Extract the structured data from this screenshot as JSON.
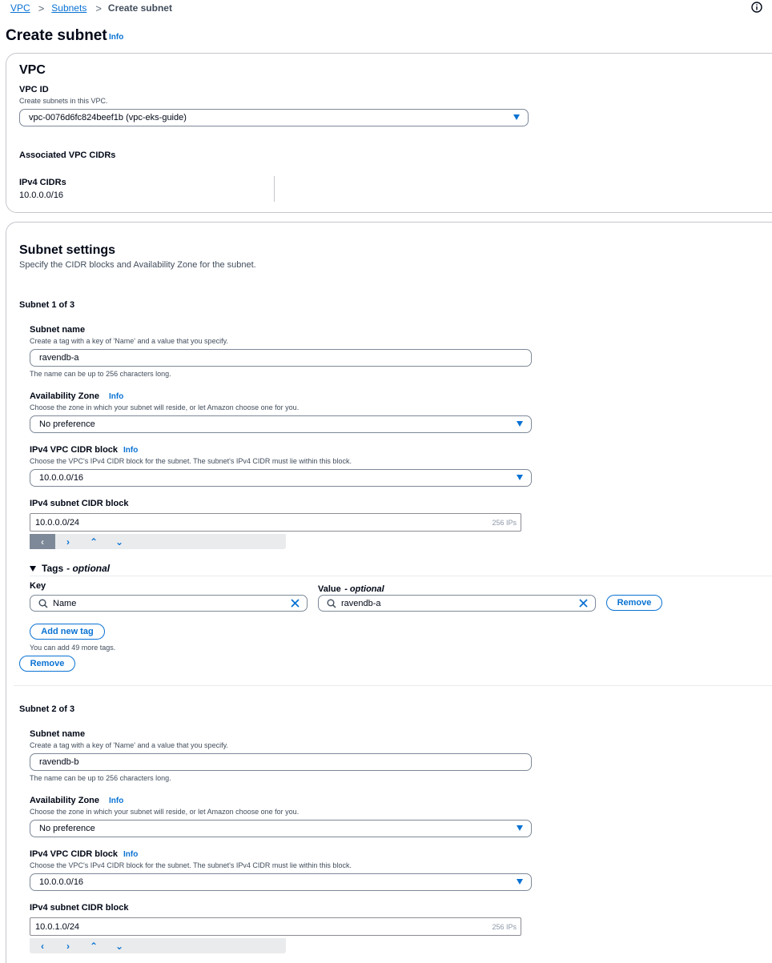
{
  "breadcrumb": {
    "vpc": "VPC",
    "subnets": "Subnets",
    "current": "Create subnet",
    "sep": ">"
  },
  "page": {
    "title": "Create subnet",
    "info": "Info"
  },
  "vpc_panel": {
    "heading": "VPC",
    "vpc_id_label": "VPC ID",
    "vpc_id_desc": "Create subnets in this VPC.",
    "vpc_id_value": "vpc-0076d6fc824beef1b (vpc-eks-guide)",
    "associated_heading": "Associated VPC CIDRs",
    "ipv4_label": "IPv4 CIDRs",
    "ipv4_value": "10.0.0.0/16"
  },
  "settings": {
    "heading": "Subnet settings",
    "desc": "Specify the CIDR blocks and Availability Zone for the subnet."
  },
  "common": {
    "name_label": "Subnet name",
    "name_desc": "Create a tag with a key of 'Name' and a value that you specify.",
    "name_hint": "The name can be up to 256 characters long.",
    "az_label": "Availability Zone",
    "az_desc": "Choose the zone in which your subnet will reside, or let Amazon choose one for you.",
    "az_value": "No preference",
    "vpc_cidr_label": "IPv4 VPC CIDR block",
    "vpc_cidr_desc": "Choose the VPC's IPv4 CIDR block for the subnet. The subnet's IPv4 CIDR must lie within this block.",
    "vpc_cidr_value": "10.0.0.0/16",
    "subnet_cidr_label": "IPv4 subnet CIDR block",
    "ips": "256 IPs",
    "info": "Info"
  },
  "subnet1": {
    "heading": "Subnet 1 of 3",
    "name_value": "ravendb-a",
    "cidr_value": "10.0.0.0/24",
    "tags_label": "Tags",
    "tags_optional": "- optional",
    "key_label": "Key",
    "value_label": "Value",
    "value_optional": "- optional",
    "tag_key": "Name",
    "tag_value": "ravendb-a",
    "remove_tag": "Remove",
    "add_tag": "Add new tag",
    "tags_hint": "You can add 49 more tags.",
    "remove_subnet": "Remove"
  },
  "subnet2": {
    "heading": "Subnet 2 of 3",
    "name_value": "ravendb-b",
    "cidr_value": "10.0.1.0/24"
  },
  "stepper": {
    "left": "‹",
    "right": "›",
    "up": "⌃",
    "down": "⌄"
  },
  "icons": {
    "info": "info-circle-icon",
    "caret": "caret-down-icon",
    "search": "search-icon",
    "clear": "clear-x-icon",
    "expand": "triangle-down-icon"
  },
  "colors": {
    "accent": "#0972d3",
    "text": "#000716",
    "muted": "#414d5c",
    "border": "#7d8998"
  }
}
